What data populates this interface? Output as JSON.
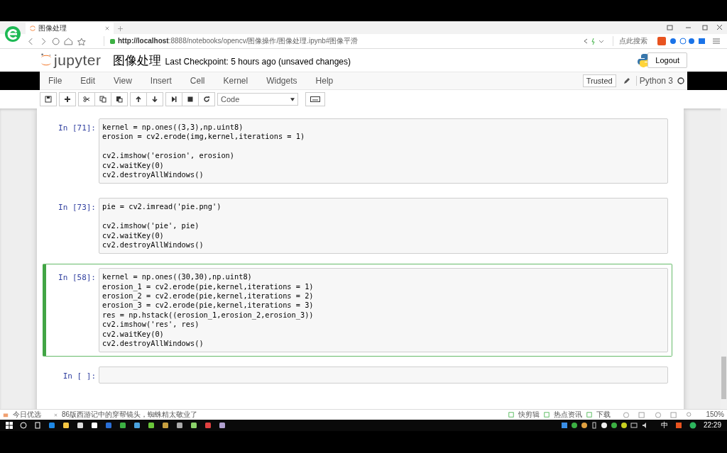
{
  "browser": {
    "tab_title": "图像处理",
    "url_host": "http://localhost",
    "url_rest": ":8888/notebooks/opencv/图像操作/图像处理.ipynb#图像平滑",
    "search": "点此搜索"
  },
  "notebook": {
    "logo": "jupyter",
    "title": "图像处理",
    "checkpoint": "Last Checkpoint: 5 hours ago (unsaved changes)",
    "logout": "Logout",
    "menu": [
      "File",
      "Edit",
      "View",
      "Insert",
      "Cell",
      "Kernel",
      "Widgets",
      "Help"
    ],
    "trusted": "Trusted",
    "kernel": "Python 3",
    "cell_type": "Code"
  },
  "cells": [
    {
      "prompt": "In [71]:",
      "selected": false,
      "code_blocks": [
        [
          "kernel = np.ones((3,3),np.uint8)",
          "erosion = cv2.erode(img,kernel,iterations = 1)"
        ],
        [
          "cv2.imshow('erosion', erosion)",
          "cv2.waitKey(0)",
          "cv2.destroyAllWindows()"
        ]
      ]
    },
    {
      "prompt": "In [73]:",
      "selected": false,
      "code_blocks": [
        [
          "pie = cv2.imread('pie.png')"
        ],
        [
          "cv2.imshow('pie', pie)",
          "cv2.waitKey(0)",
          "cv2.destroyAllWindows()"
        ]
      ]
    },
    {
      "prompt": "In [58]:",
      "selected": true,
      "code_blocks": [
        [
          "kernel = np.ones((30,30),np.uint8)",
          "erosion_1 = cv2.erode(pie,kernel,iterations = 1)",
          "erosion_2 = cv2.erode(pie,kernel,iterations = 2)",
          "erosion_3 = cv2.erode(pie,kernel,iterations = 3)",
          "res = np.hstack((erosion_1,erosion_2,erosion_3))",
          "cv2.imshow('res', res)",
          "cv2.waitKey(0)",
          "cv2.destroyAllWindows()"
        ]
      ]
    },
    {
      "prompt": "In [ ]:",
      "selected": false
    }
  ],
  "status_bar": {
    "left": [
      "今日优选",
      "86版西游记中的穿帮镜头，蜘蛛精太敬业了"
    ],
    "right": [
      "快剪辑",
      "热点资讯",
      "下载"
    ],
    "zoom": "150%"
  },
  "taskbar": {
    "ime": "中",
    "clock": "22:29"
  }
}
